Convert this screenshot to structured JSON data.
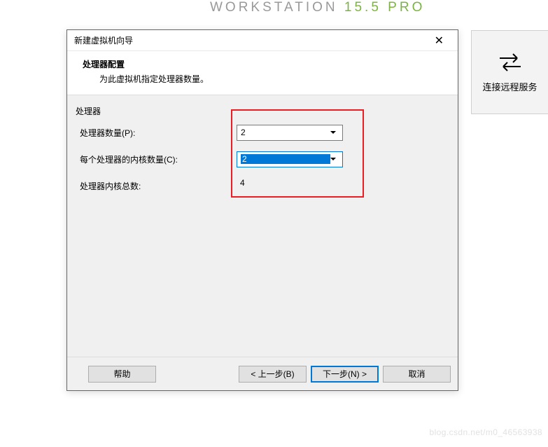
{
  "bg": {
    "workstation": "WORKSTATION",
    "version": "15.5",
    "pro": "PRO"
  },
  "rightPanel": {
    "label": "连接远程服务"
  },
  "dialog": {
    "title": "新建虚拟机向导",
    "header": {
      "title": "处理器配置",
      "sub": "为此虚拟机指定处理器数量。"
    },
    "group": {
      "legend": "处理器",
      "rows": {
        "processors": {
          "label": "处理器数量(P):",
          "value": "2"
        },
        "cores": {
          "label": "每个处理器的内核数量(C):",
          "value": "2"
        },
        "total": {
          "label": "处理器内核总数:",
          "value": "4"
        }
      }
    },
    "buttons": {
      "help": "帮助",
      "back": "< 上一步(B)",
      "next": "下一步(N) >",
      "cancel": "取消"
    }
  },
  "watermark": "blog.csdn.net/m0_46563938"
}
